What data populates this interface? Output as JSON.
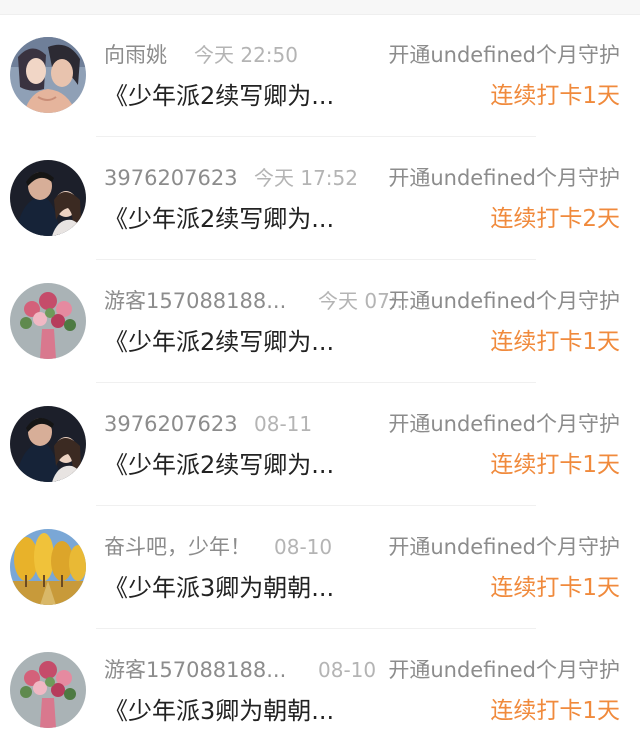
{
  "items": [
    {
      "user": "向雨姚",
      "time": "今天 22:50",
      "guard": "开通undefined个月守护",
      "book": "《少年派2续写卿为...",
      "streak": "连续打卡1天",
      "avatar": "anime-couple-avatar"
    },
    {
      "user": "3976207623",
      "time": "今天 17:52",
      "guard": "开通undefined个月守护",
      "book": "《少年派2续写卿为...",
      "streak": "连续打卡2天",
      "avatar": "couple-photo-avatar"
    },
    {
      "user": "游客157088188...",
      "time": "今天 07:...",
      "guard": "开通undefined个月守护",
      "book": "《少年派2续写卿为...",
      "streak": "连续打卡1天",
      "avatar": "flower-vase-avatar"
    },
    {
      "user": "3976207623",
      "time": "08-11",
      "guard": "开通undefined个月守护",
      "book": "《少年派2续写卿为...",
      "streak": "连续打卡1天",
      "avatar": "couple-photo-avatar"
    },
    {
      "user": "奋斗吧，少年！",
      "time": "08-10",
      "guard": "开通undefined个月守护",
      "book": "《少年派3卿为朝朝...",
      "streak": "连续打卡1天",
      "avatar": "autumn-trees-avatar"
    },
    {
      "user": "游客157088188...",
      "time": "08-10",
      "guard": "开通undefined个月守护",
      "book": "《少年派3卿为朝朝...",
      "streak": "连续打卡1天",
      "avatar": "flower-vase-avatar"
    }
  ],
  "colors": {
    "accent": "#f08a3c",
    "username": "#8c8c8c",
    "time": "#b4b4b4",
    "title": "#222222"
  }
}
